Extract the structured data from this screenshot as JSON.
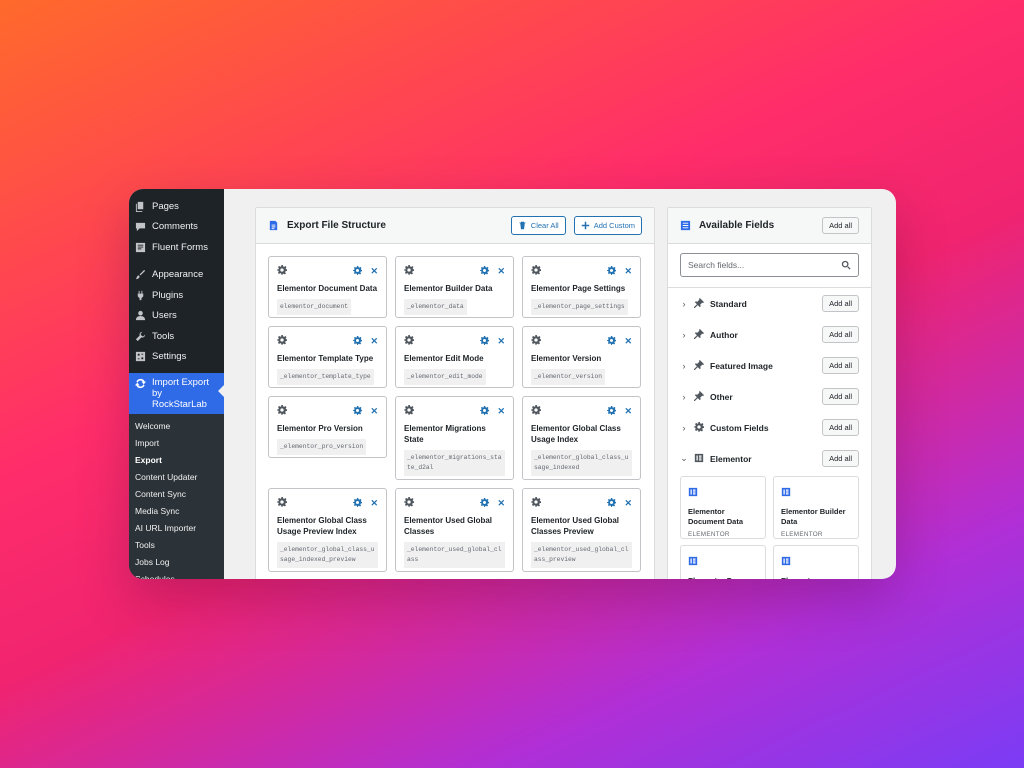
{
  "sidebar": {
    "items": [
      {
        "label": "Pages",
        "icon": "pages-icon"
      },
      {
        "label": "Comments",
        "icon": "comments-icon"
      },
      {
        "label": "Fluent Forms",
        "icon": "forms-icon"
      },
      {
        "label": "Appearance",
        "icon": "paintbrush-icon"
      },
      {
        "label": "Plugins",
        "icon": "plugin-icon"
      },
      {
        "label": "Users",
        "icon": "users-icon"
      },
      {
        "label": "Tools",
        "icon": "wrench-icon"
      },
      {
        "label": "Settings",
        "icon": "settings-icon"
      }
    ],
    "active_plugin": "Import Export by RockStarLab",
    "submenu": [
      "Welcome",
      "Import",
      "Export",
      "Content Updater",
      "Content Sync",
      "Media Sync",
      "AI URL Importer",
      "Tools",
      "Jobs Log",
      "Schedules"
    ],
    "current_submenu": "Export"
  },
  "structure": {
    "title": "Export File Structure",
    "clear_all": "Clear All",
    "add_custom": "Add Custom",
    "cards": [
      {
        "title": "Elementor Document Data",
        "key": "elementor_document"
      },
      {
        "title": "Elementor Builder Data",
        "key": "_elementor_data"
      },
      {
        "title": "Elementor Page Settings",
        "key": "_elementor_page_settings"
      },
      {
        "title": "Elementor Template Type",
        "key": "_elementor_template_type"
      },
      {
        "title": "Elementor Edit Mode",
        "key": "_elementor_edit_mode"
      },
      {
        "title": "Elementor Version",
        "key": "_elementor_version"
      },
      {
        "title": "Elementor Pro Version",
        "key": "_elementor_pro_version"
      },
      {
        "title": "Elementor Migrations State",
        "key": "_elementor_migrations_state_d2al"
      },
      {
        "title": "Elementor Global Class Usage Index",
        "key": "_elementor_global_class_usage_indexed"
      },
      {
        "title": "Elementor Global Class Usage Preview Index",
        "key": "_elementor_global_class_usage_indexed_preview"
      },
      {
        "title": "Elementor Used Global Classes",
        "key": "_elementor_used_global_class"
      },
      {
        "title": "Elementor Used Global Classes Preview",
        "key": "_elementor_used_global_class_preview"
      }
    ]
  },
  "available": {
    "title": "Available Fields",
    "add_all": "Add all",
    "search_placeholder": "Search fields...",
    "groups": [
      {
        "label": "Standard",
        "icon": "pin-icon"
      },
      {
        "label": "Author",
        "icon": "pin-icon"
      },
      {
        "label": "Featured Image",
        "icon": "pin-icon"
      },
      {
        "label": "Other",
        "icon": "pin-icon"
      },
      {
        "label": "Custom Fields",
        "icon": "gear-icon"
      },
      {
        "label": "Elementor",
        "icon": "elementor-icon"
      }
    ],
    "fields": [
      {
        "title": "Elementor Document Data",
        "source": "ELEMENTOR"
      },
      {
        "title": "Elementor Builder Data",
        "source": "ELEMENTOR"
      },
      {
        "title": "Elementor Page",
        "source": ""
      },
      {
        "title": "Elementor",
        "source": ""
      }
    ]
  },
  "colors": {
    "accent": "#2f6ae7",
    "sidebar_bg": "#1d2327",
    "link": "#2271b1"
  }
}
